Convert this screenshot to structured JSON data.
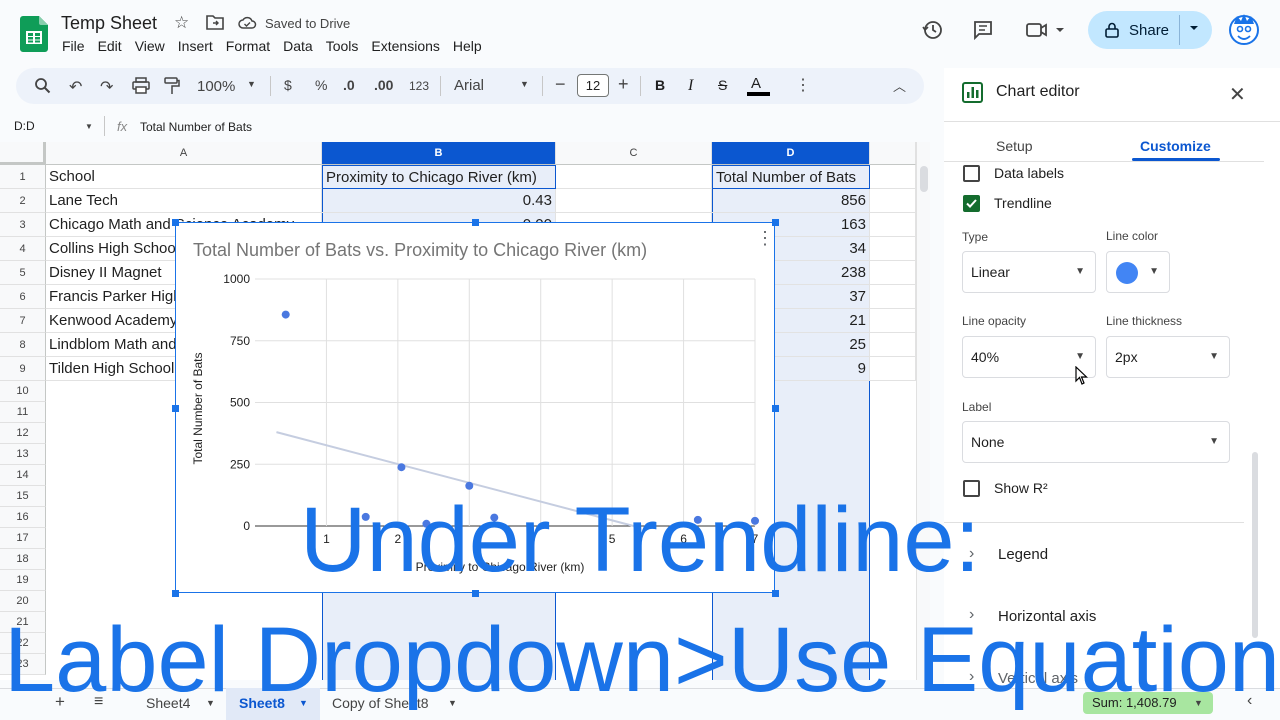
{
  "header": {
    "doc_title": "Temp Sheet",
    "saved_status": "Saved to Drive",
    "menu": [
      "File",
      "Edit",
      "View",
      "Insert",
      "Format",
      "Data",
      "Tools",
      "Extensions",
      "Help"
    ],
    "share_label": "Share"
  },
  "toolbar": {
    "zoom": "100%",
    "currency": "$",
    "percent": "%",
    "dec_decrease": ".0",
    "dec_increase": ".00",
    "number_format": "123",
    "font": "Arial",
    "font_size": "12",
    "bold": "B",
    "italic": "I",
    "strike": "S",
    "text_color": "A"
  },
  "formula_bar": {
    "name_box": "D:D",
    "fx": "fx",
    "content": "Total Number of Bats"
  },
  "grid": {
    "columns": [
      "A",
      "B",
      "C",
      "D"
    ],
    "rows": [
      "1",
      "2",
      "3",
      "4",
      "5",
      "6",
      "7",
      "8",
      "9",
      "10",
      "11",
      "12",
      "13",
      "14",
      "15",
      "16",
      "17",
      "18",
      "19",
      "20",
      "21",
      "22",
      "23"
    ],
    "col_a": [
      "School",
      "Lane Tech",
      "Chicago Math and Science Academy",
      "Collins High School",
      "Disney II Magnet",
      "Francis Parker High",
      "Kenwood Academy",
      "Lindblom Math and Science",
      "Tilden High School"
    ],
    "col_b": [
      "Proximity to Chicago River (km)",
      "0.43",
      "0.00"
    ],
    "col_d": [
      "Total Number of Bats",
      "856",
      "163",
      "34",
      "238",
      "37",
      "21",
      "25",
      "9"
    ]
  },
  "chart_data": {
    "type": "scatter",
    "title": "Total Number of Bats vs. Proximity to Chicago River (km)",
    "xlabel": "Proximity to Chicago River (km)",
    "ylabel": "Total Number of Bats",
    "xlim": [
      0,
      7
    ],
    "ylim": [
      0,
      1000
    ],
    "y_ticks": [
      "0",
      "250",
      "500",
      "750",
      "1000"
    ],
    "x_ticks": [
      "1",
      "2",
      "",
      "",
      "5",
      "6",
      "7"
    ],
    "points": [
      {
        "x": 0.43,
        "y": 856
      },
      {
        "x": 2.05,
        "y": 238
      },
      {
        "x": 3.0,
        "y": 163
      },
      {
        "x": 1.55,
        "y": 37
      },
      {
        "x": 2.4,
        "y": 9
      },
      {
        "x": 3.35,
        "y": 34
      },
      {
        "x": 6.2,
        "y": 25
      },
      {
        "x": 7.0,
        "y": 21
      }
    ],
    "trendline": {
      "type": "linear",
      "x": [
        0.3,
        5.3
      ],
      "y": [
        380,
        0
      ]
    },
    "point_color": "#4a78e0",
    "trendline_color": "#c5cde0",
    "grid": true
  },
  "sheets": {
    "tabs": [
      "Sheet4",
      "Sheet8",
      "Copy of Sheet8"
    ],
    "active": "Sheet8",
    "sum": "Sum: 1,408.79"
  },
  "panel": {
    "title": "Chart editor",
    "tab_setup": "Setup",
    "tab_customize": "Customize",
    "data_labels": "Data labels",
    "trendline": "Trendline",
    "type_label": "Type",
    "type_value": "Linear",
    "line_color_label": "Line color",
    "line_color": "#4285f4",
    "opacity_label": "Line opacity",
    "opacity_value": "40%",
    "thickness_label": "Line thickness",
    "thickness_value": "2px",
    "label_label": "Label",
    "label_value": "None",
    "show_r2": "Show R²",
    "sections": [
      "Legend",
      "Horizontal axis",
      "Vertical axis"
    ]
  },
  "overlay": {
    "line1": "Under Trendline:",
    "line2": "Label Dropdown>Use Equation"
  }
}
